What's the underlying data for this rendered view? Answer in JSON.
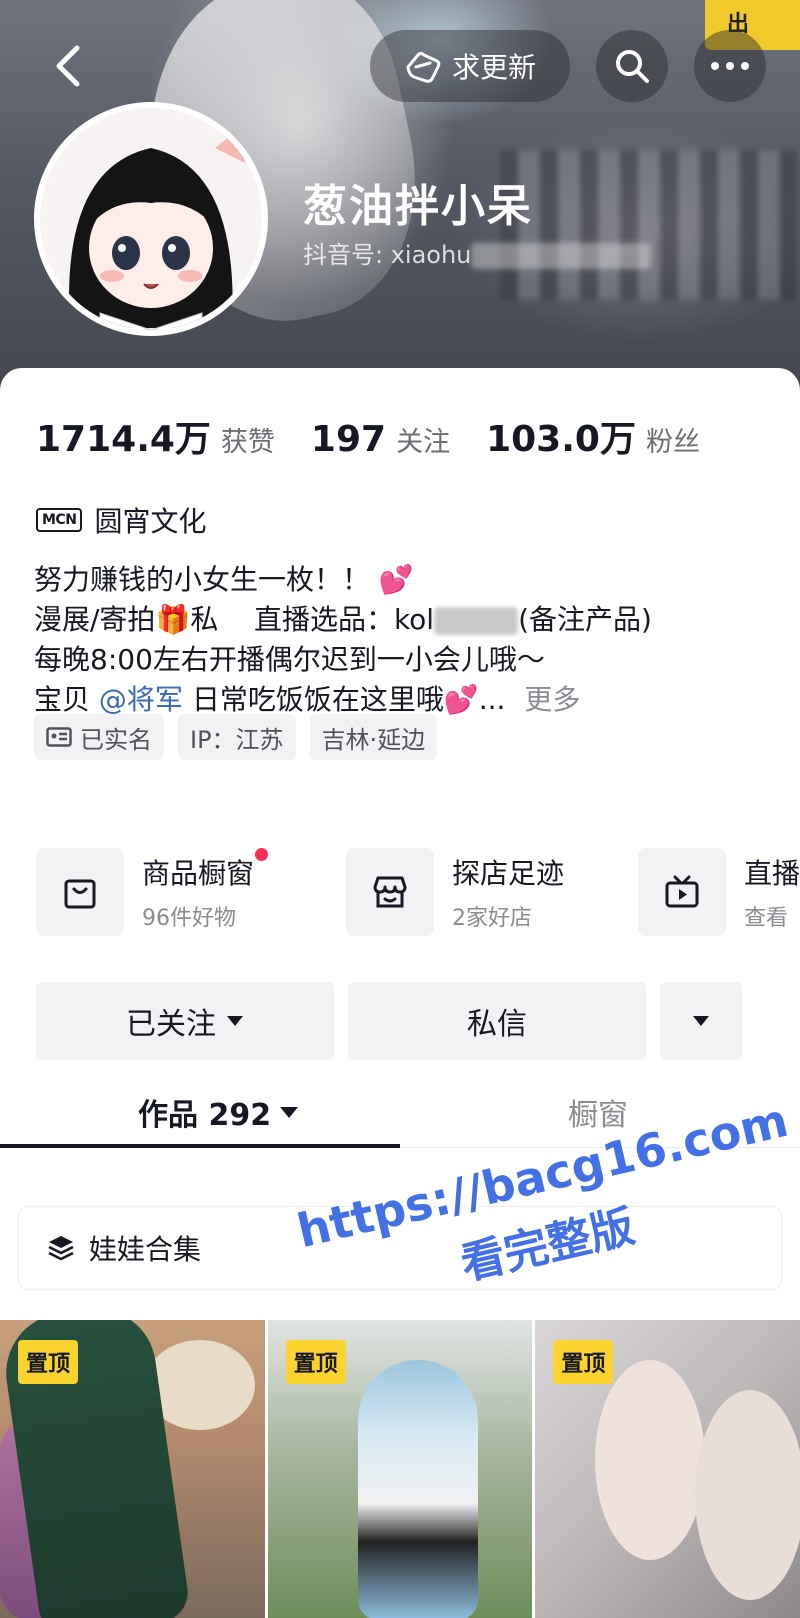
{
  "header": {
    "refresh_label": "求更新",
    "sign_text": "出"
  },
  "profile": {
    "name": "葱油拌小呆",
    "douyin_id_label": "抖音号: xiaohu"
  },
  "stats": [
    {
      "value": "1714.4万",
      "label": "获赞"
    },
    {
      "value": "197",
      "label": "关注"
    },
    {
      "value": "103.0万",
      "label": "粉丝"
    }
  ],
  "mcn": {
    "badge": "MCN",
    "name": "圆宵文化"
  },
  "bio": {
    "line1": "努力赚钱的小女生一枚！！",
    "line1_emoji": "💕",
    "line2_a": "漫展/寄拍",
    "line2_gift": "🎁",
    "line2_b": "私",
    "line2_c": "直播选品：kol",
    "line2_d": "(备注产品)",
    "line3": "每晚8:00左右开播偶尔迟到一小会儿哦～",
    "line4_a": "宝贝",
    "line4_mention": "@将军",
    "line4_b": "日常吃饭饭在这里哦",
    "line4_emoji": "💕",
    "line4_ellipsis": "...",
    "more": "更多"
  },
  "tags": [
    {
      "label": "已实名",
      "icon": "id-card-icon"
    },
    {
      "label": "IP：江苏"
    },
    {
      "label": "吉林·延边"
    }
  ],
  "services": [
    {
      "title": "商品橱窗",
      "sub": "96件好物",
      "icon": "shopping-bag-icon",
      "dot": true
    },
    {
      "title": "探店足迹",
      "sub": "2家好店",
      "icon": "store-icon"
    },
    {
      "title": "直播",
      "sub": "查看",
      "icon": "tv-icon"
    }
  ],
  "actions": {
    "follow": "已关注",
    "message": "私信"
  },
  "tabs": {
    "works": "作品 292",
    "window": "橱窗"
  },
  "collection": {
    "label": "娃娃合集"
  },
  "thumbs": [
    {
      "pin": "置顶"
    },
    {
      "pin": "置顶"
    },
    {
      "pin": "置顶"
    }
  ],
  "watermark": {
    "url": "https://bacg16.com",
    "text": "看完整版"
  },
  "colors": {
    "accent_red": "#fe2c55",
    "mention_blue": "#3a6ab5",
    "pin_yellow": "#fbd32e",
    "watermark_blue": "#4470e6"
  }
}
